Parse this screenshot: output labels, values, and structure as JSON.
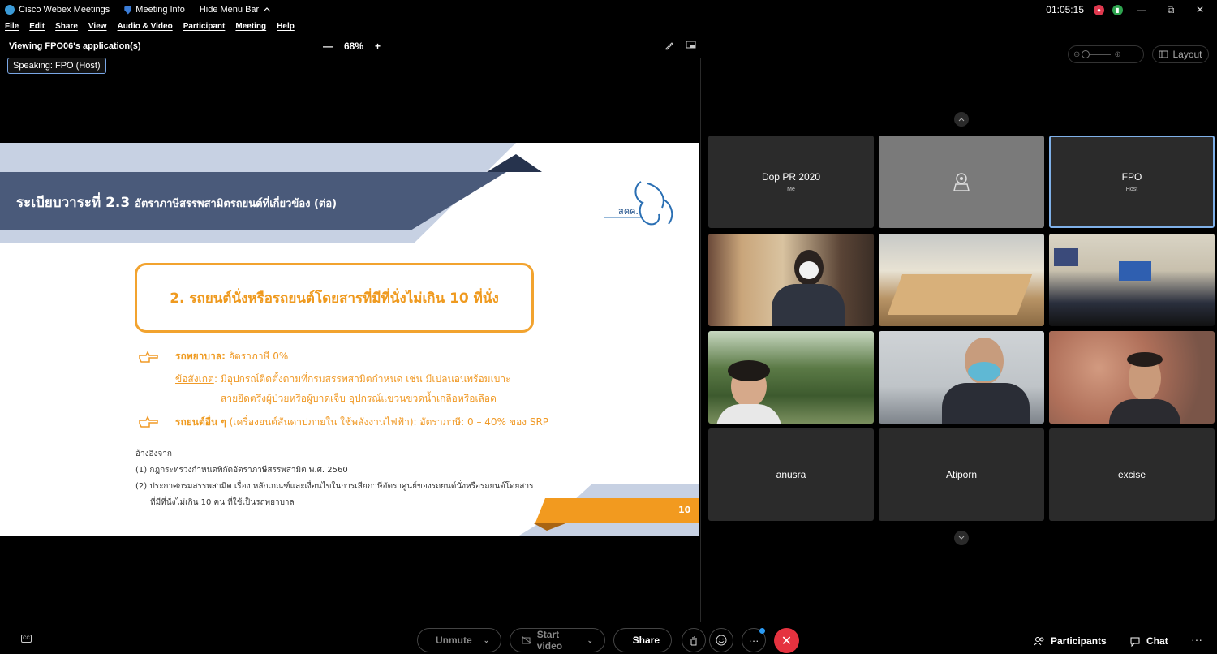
{
  "titlebar": {
    "app_name": "Cisco Webex Meetings",
    "meeting_info": "Meeting Info",
    "hide_menu": "Hide Menu Bar",
    "time": "01:05:15",
    "minimize": "—",
    "restore": "⧉",
    "close": "✕"
  },
  "menu": [
    "File",
    "Edit",
    "Share",
    "View",
    "Audio & Video",
    "Participant",
    "Meeting",
    "Help"
  ],
  "viewing": {
    "title": "Viewing FPO06's application(s)",
    "zoom_out": "—",
    "zoom_level": "68%",
    "zoom_in": "+",
    "speaking": "Speaking: FPO (Host)"
  },
  "slide": {
    "title_main": "ระเบียบวาระที่ 2.3",
    "title_sub": "อัตราภาษีสรรพสามิตรถยนต์ที่เกี่ยวข้อง (ต่อ)",
    "logo_text": "สคค.",
    "box_heading": "2. รถยนต์นั่งหรือรถยนต์โดยสารที่มีที่นั่งไม่เกิน 10 ที่นั่ง",
    "bullet1_bold": "รถพยาบาล:",
    "bullet1_text": " อัตราภาษี 0%",
    "note_label": "ข้อสังเกต",
    "note_line1": ": มีอุปกรณ์ติดตั้งตามที่กรมสรรพสามิตกำหนด เช่น มีเปลนอนพร้อมเบาะ",
    "note_line2": "สายยึดตรึงผู้ป่วยหรือผู้บาดเจ็บ อุปกรณ์แขวนขวดน้ำเกลือหรือเลือด",
    "bullet2_bold": "รถยนต์อื่น ๆ",
    "bullet2_text": " (เครื่องยนต์สันดาปภายใน ใช้พลังงานไฟฟ้า): อัตราภาษี: 0 – 40% ของ SRP",
    "ref_heading": "อ้างอิงจาก",
    "ref1": "(1) กฎกระทรวงกำหนดพิกัดอัตราภาษีสรรพสามิต พ.ศ. 2560",
    "ref2_line1": "(2) ประกาศกรมสรรพสามิต เรื่อง หลักเกณฑ์และเงื่อนไขในการเสียภาษีอัตราศูนย์ของรถยนต์นั่งหรือรถยนต์โดยสาร",
    "ref2_line2": "ที่มีที่นั่งไม่เกิน 10 คน ที่ใช้เป็นรถพยาบาล",
    "page_number": "10"
  },
  "video_panel": {
    "layout_label": "Layout",
    "tiles": [
      {
        "name": "Dop PR 2020",
        "sub": "Me",
        "type": "name"
      },
      {
        "name": "",
        "sub": "",
        "type": "camera"
      },
      {
        "name": "FPO",
        "sub": "Host",
        "type": "name"
      },
      {
        "name": "",
        "sub": "",
        "type": "video"
      },
      {
        "name": "",
        "sub": "",
        "type": "video"
      },
      {
        "name": "",
        "sub": "",
        "type": "video"
      },
      {
        "name": "",
        "sub": "",
        "type": "video"
      },
      {
        "name": "",
        "sub": "",
        "type": "video"
      },
      {
        "name": "",
        "sub": "",
        "type": "video"
      },
      {
        "name": "anusra",
        "sub": "",
        "type": "name"
      },
      {
        "name": "Atiporn",
        "sub": "",
        "type": "name"
      },
      {
        "name": "excise",
        "sub": "",
        "type": "name"
      }
    ]
  },
  "toolbar": {
    "cc": "CC",
    "unmute": "Unmute",
    "start_video": "Start video",
    "share": "Share",
    "participants": "Participants",
    "chat": "Chat",
    "more": "···"
  },
  "colors": {
    "slide_navy": "#4a5a7a",
    "slide_light": "#c7d1e3",
    "slide_orange": "#f29a1f",
    "leave_red": "#e5323f",
    "active_border": "#7fb0e8"
  }
}
